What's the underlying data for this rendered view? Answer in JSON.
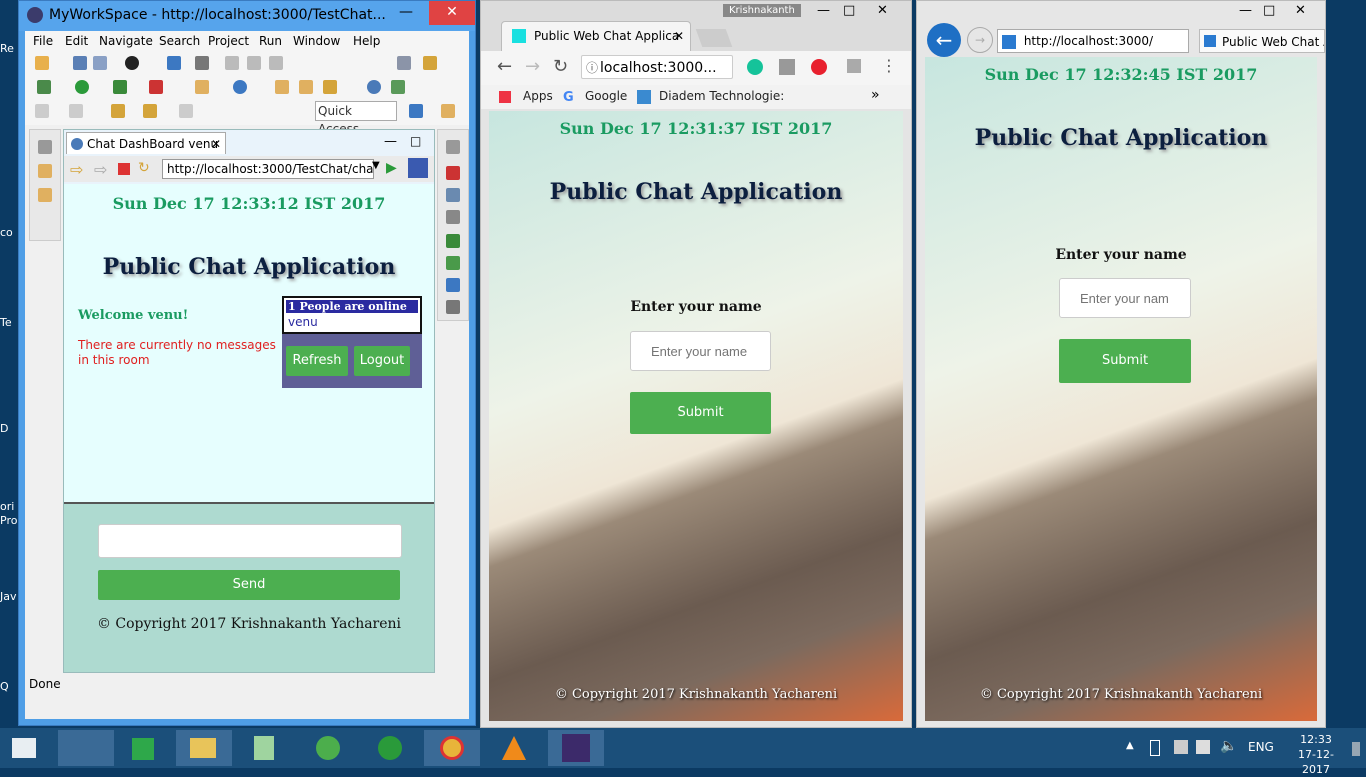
{
  "desktop": {
    "labels": [
      "Re",
      "co",
      "Te",
      "D",
      "ori",
      "Pro",
      "Jav",
      "Q"
    ]
  },
  "eclipse": {
    "title": "MyWorkSpace - http://localhost:3000/TestChat...",
    "menu": [
      "File",
      "Edit",
      "Navigate",
      "Search",
      "Project",
      "Run",
      "Window",
      "Help"
    ],
    "quick_access": "Quick Access",
    "tab_label": "Chat DashBoard venu",
    "url": "http://localhost:3000/TestChat/cha",
    "status": "Done",
    "page": {
      "date": "Sun Dec 17 12:33:12 IST 2017",
      "title": "Public Chat Application",
      "welcome": "Welcome venu!",
      "no_messages": "There are currently no messages in this room",
      "online_header": "1 People are online",
      "online_users": [
        "venu"
      ],
      "refresh": "Refresh",
      "logout": "Logout",
      "send": "Send",
      "copyright": "© Copyright 2017 Krishnakanth Yachareni"
    }
  },
  "chrome": {
    "user": "Krishnakanth",
    "tab_title": "Public Web Chat Applica",
    "omnibox": "localhost:3000...",
    "bookmarks": [
      "Apps",
      "Google",
      "Diadem Technologie:"
    ],
    "page": {
      "date": "Sun Dec 17 12:31:37 IST 2017",
      "title": "Public Chat Application",
      "name_label": "Enter your name",
      "name_placeholder": "Enter your name",
      "submit": "Submit",
      "copyright": "© Copyright 2017 Krishnakanth Yachareni"
    }
  },
  "ie": {
    "url": "http://localhost:3000/",
    "tab_title": "Public Web Chat A",
    "page": {
      "date": "Sun Dec 17 12:32:45 IST 2017",
      "title": "Public Chat Application",
      "name_label": "Enter your name",
      "name_placeholder": "Enter your nam",
      "submit": "Submit",
      "copyright": "© Copyright 2017 Krishnakanth Yachareni"
    }
  },
  "taskbar": {
    "language": "ENG",
    "time": "12:33",
    "date": "17-12-2017"
  },
  "colors": {
    "date_green": "#1a9b61",
    "button_green": "#4caf50",
    "title_navy": "#0c1f3f",
    "welcome_green": "#1a9b61",
    "no_msg_red": "#e02020",
    "online_header_bg": "#2a2aa0"
  }
}
